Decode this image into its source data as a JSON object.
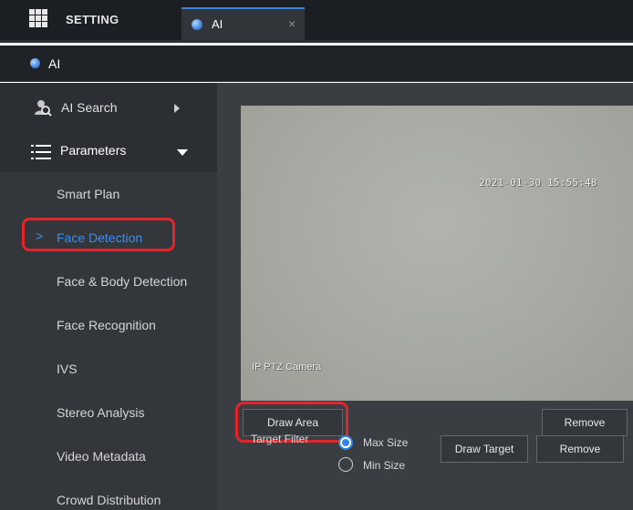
{
  "topbar": {
    "menu_icon": "grid-menu-icon",
    "setting_tab": "SETTING",
    "ai_tab": "AI",
    "ai_tab_icon": "globe-icon",
    "close_symbol": "×"
  },
  "subheader": {
    "title": "AI",
    "icon": "globe-icon"
  },
  "sidebar": {
    "ai_search": {
      "label": "AI Search",
      "icon": "search-person-icon",
      "arrow": "caret-right-icon"
    },
    "parameters": {
      "label": "Parameters",
      "icon": "list-icon",
      "arrow": "caret-down-icon"
    },
    "items": [
      {
        "label": "Smart Plan",
        "active": false
      },
      {
        "label": "Face Detection",
        "active": true
      },
      {
        "label": "Face & Body Detection",
        "active": false
      },
      {
        "label": "Face Recognition",
        "active": false
      },
      {
        "label": "IVS",
        "active": false
      },
      {
        "label": "Stereo Analysis",
        "active": false
      },
      {
        "label": "Video Metadata",
        "active": false
      },
      {
        "label": "Crowd Distribution",
        "active": false
      }
    ],
    "active_chevron": ">"
  },
  "main": {
    "video": {
      "timestamp": "2021-01-30 15:55:48",
      "camera_name": "IP PTZ Camera"
    },
    "draw_area_label": "Draw Area",
    "remove_label": "Remove",
    "target_filter": {
      "label": "Target Filter",
      "options": [
        {
          "label": "Max Size",
          "checked": true
        },
        {
          "label": "Min Size",
          "checked": false
        }
      ],
      "draw_target_label": "Draw Target",
      "remove_label": "Remove"
    }
  },
  "colors": {
    "accent": "#3c8cf0",
    "highlight": "#e3242b",
    "sidebar_bg": "#2b2e32",
    "main_bg": "#3a3e43"
  }
}
